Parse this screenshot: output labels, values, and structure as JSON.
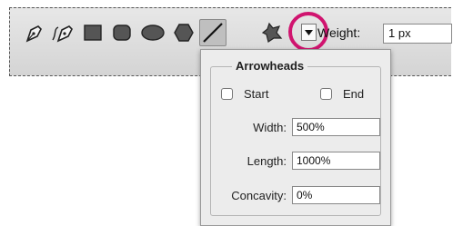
{
  "toolbar": {
    "icons": [
      "pen-icon",
      "freeform-pen-icon",
      "rectangle-icon",
      "rounded-rectangle-icon",
      "ellipse-icon",
      "polygon-icon",
      "line-icon",
      "custom-shape-icon"
    ],
    "weight_label": "Weight:",
    "weight_value": "1 px",
    "highlight_color": "#d0146f"
  },
  "arrowheads": {
    "title": "Arrowheads",
    "start_label": "Start",
    "end_label": "End",
    "width_label": "Width:",
    "width_value": "500%",
    "length_label": "Length:",
    "length_value": "1000%",
    "concavity_label": "Concavity:",
    "concavity_value": "0%"
  }
}
